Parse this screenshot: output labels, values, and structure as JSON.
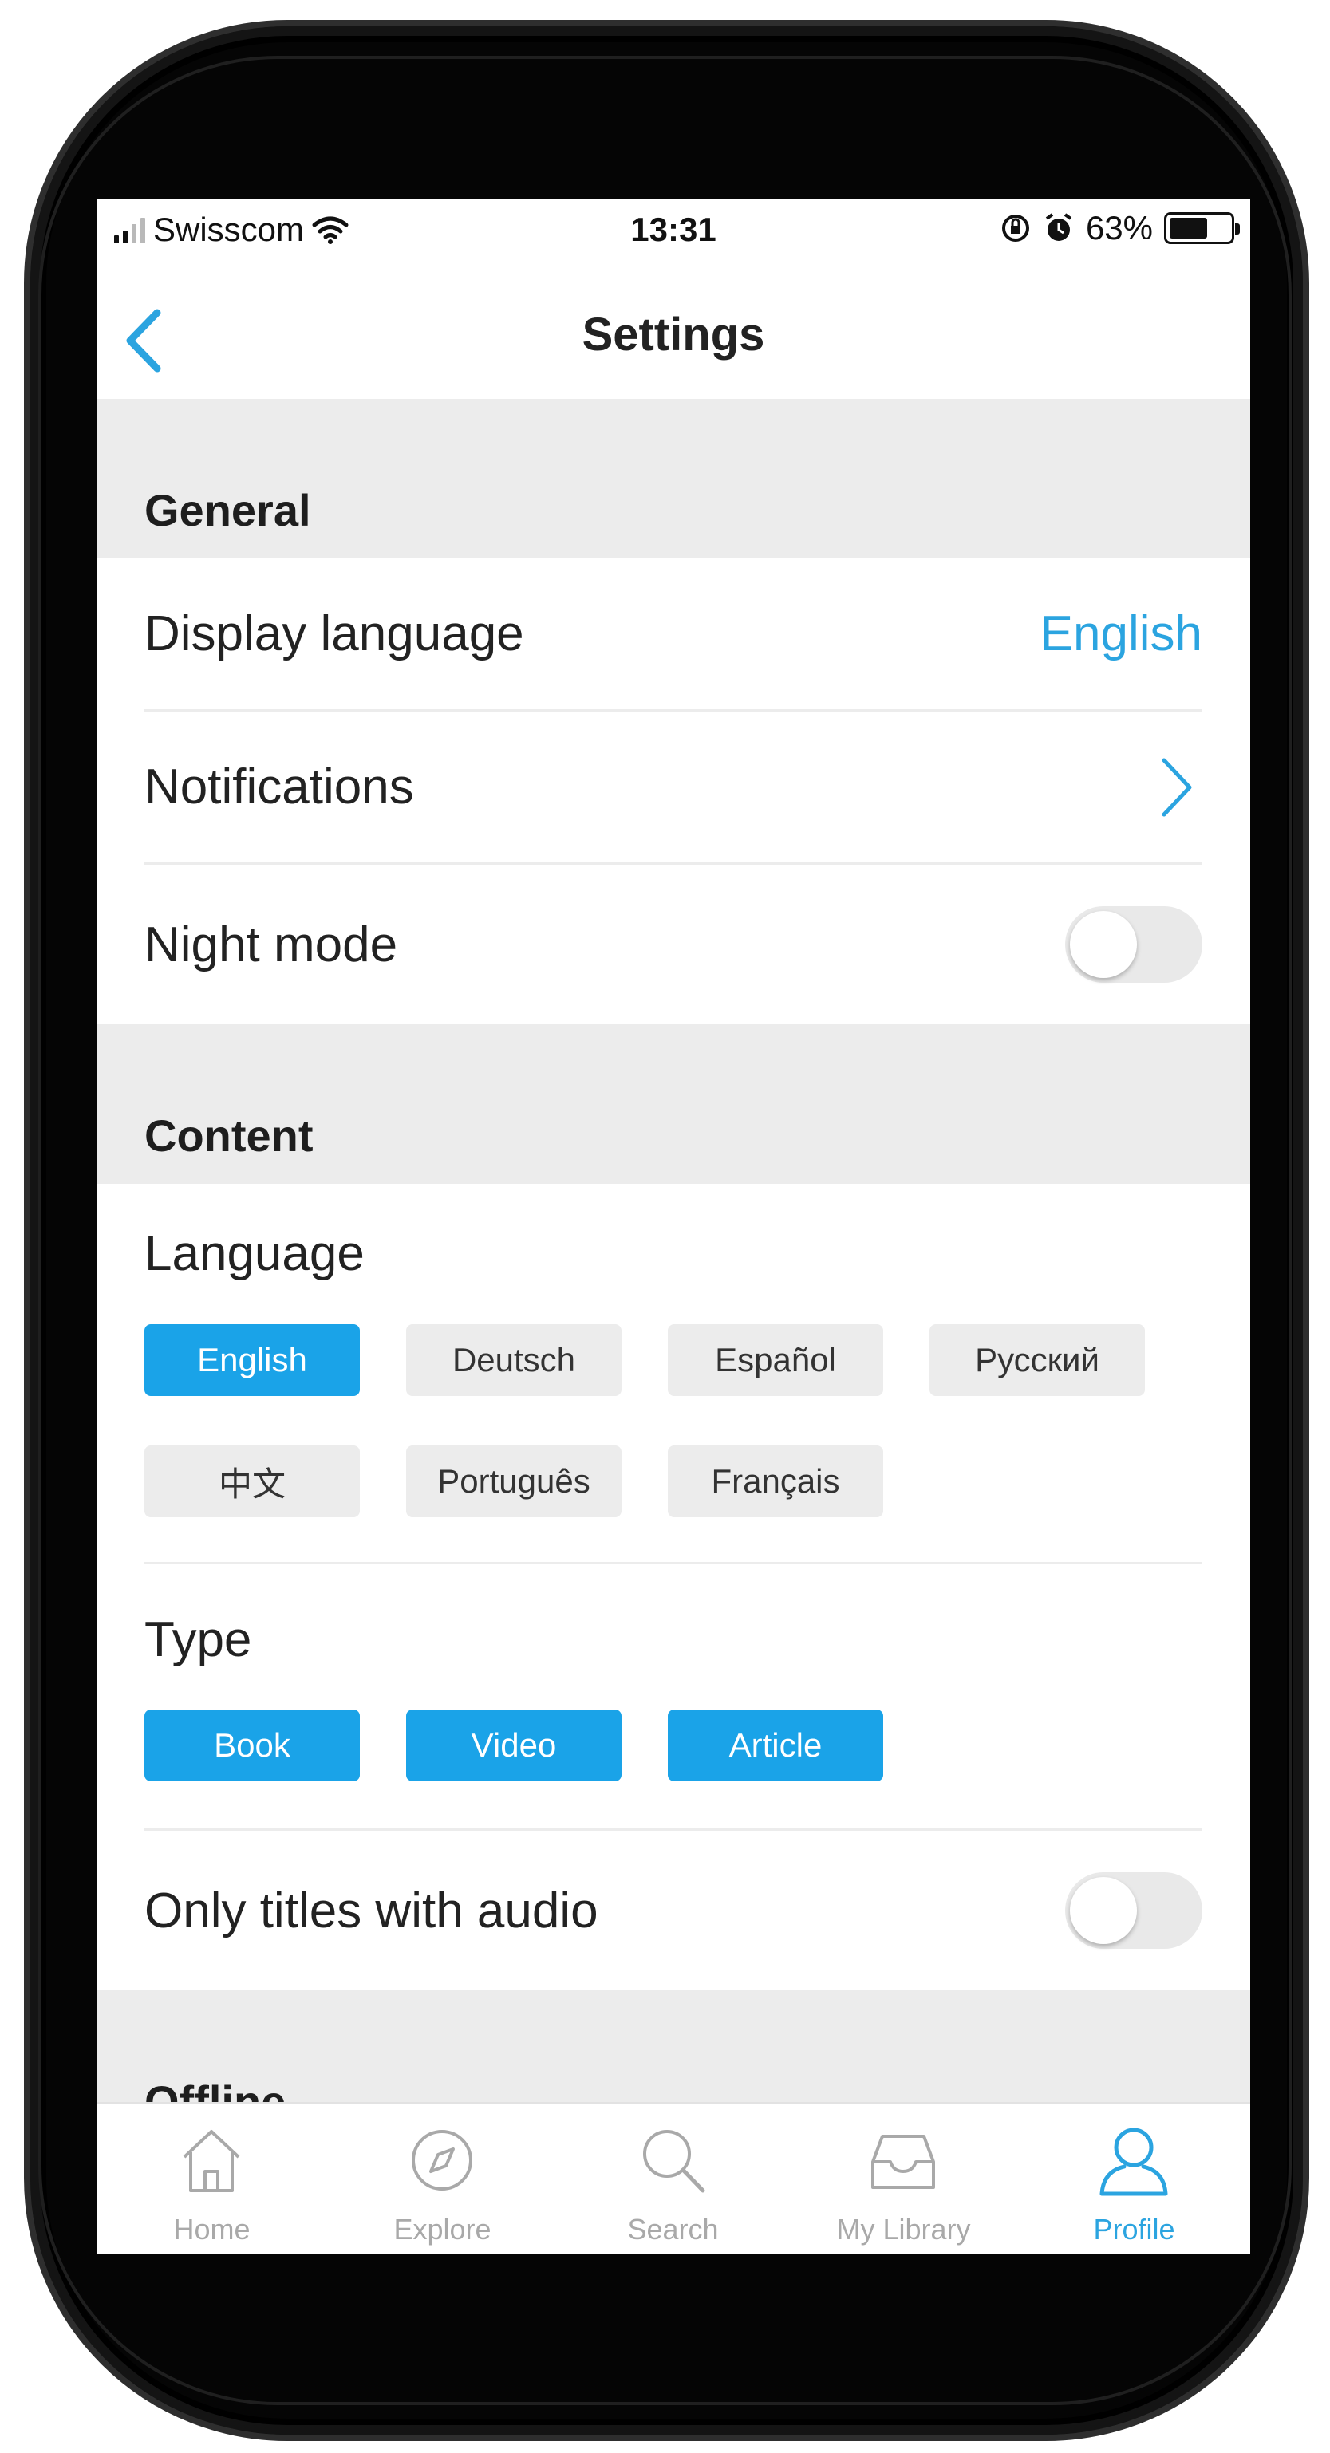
{
  "status_bar": {
    "carrier": "Swisscom",
    "time": "13:31",
    "battery": "63%",
    "battery_level": 0.63
  },
  "header": {
    "title": "Settings"
  },
  "general": {
    "title": "General",
    "display_language_label": "Display language",
    "display_language_value": "English",
    "notifications_label": "Notifications",
    "night_mode_label": "Night mode",
    "night_mode_on": false
  },
  "content": {
    "title": "Content",
    "language_label": "Language",
    "languages": [
      {
        "label": "English",
        "selected": true
      },
      {
        "label": "Deutsch",
        "selected": false
      },
      {
        "label": "Español",
        "selected": false
      },
      {
        "label": "Русский",
        "selected": false
      },
      {
        "label": "中文",
        "selected": false
      },
      {
        "label": "Português",
        "selected": false
      },
      {
        "label": "Français",
        "selected": false
      }
    ],
    "type_label": "Type",
    "types": [
      {
        "label": "Book",
        "selected": true
      },
      {
        "label": "Video",
        "selected": true
      },
      {
        "label": "Article",
        "selected": true
      }
    ],
    "audio_only_label": "Only titles with audio",
    "audio_only_on": false
  },
  "offline": {
    "title": "Offline"
  },
  "tabs": [
    {
      "label": "Home",
      "icon": "home-icon",
      "active": false
    },
    {
      "label": "Explore",
      "icon": "compass-icon",
      "active": false
    },
    {
      "label": "Search",
      "icon": "search-icon",
      "active": false
    },
    {
      "label": "My Library",
      "icon": "inbox-icon",
      "active": false
    },
    {
      "label": "Profile",
      "icon": "user-icon",
      "active": true
    }
  ],
  "colors": {
    "accent": "#1aa3e8",
    "link": "#2ba4e0",
    "section_bg": "#ececec",
    "inactive_tab": "#a9a9a9"
  }
}
